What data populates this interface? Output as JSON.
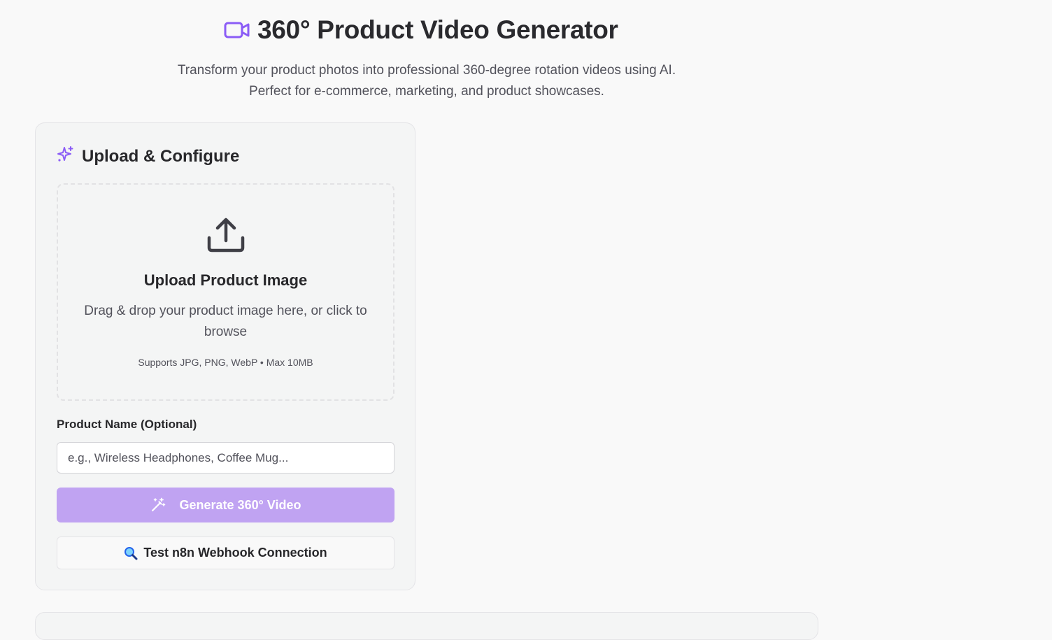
{
  "header": {
    "title": "360° Product Video Generator",
    "title_icon": "video-camera-icon",
    "subtitle_line1": "Transform your product photos into professional 360-degree rotation videos using AI.",
    "subtitle_line2": "Perfect for e-commerce, marketing, and product showcases."
  },
  "upload_card": {
    "title": "Upload & Configure",
    "title_icon": "sparkles-icon",
    "dropzone": {
      "icon": "upload-icon",
      "title": "Upload Product Image",
      "description": "Drag & drop your product image here, or click to browse",
      "note": "Supports JPG, PNG, WebP • Max 10MB"
    },
    "product_name": {
      "label": "Product Name (Optional)",
      "value": "",
      "placeholder": "e.g., Wireless Headphones, Coffee Mug..."
    },
    "generate_button": {
      "label": "Generate 360° Video",
      "icon": "magic-wand-icon",
      "disabled": true
    },
    "test_button": {
      "label": "Test n8n Webhook Connection",
      "icon": "magnifying-glass-icon"
    }
  },
  "colors": {
    "accent": "#8b5cf6",
    "accent_disabled": "#c0a3f2",
    "background": "#f9f9f9",
    "card_background": "#f4f5f5",
    "text": "#27272a",
    "muted_text": "#52525b"
  }
}
